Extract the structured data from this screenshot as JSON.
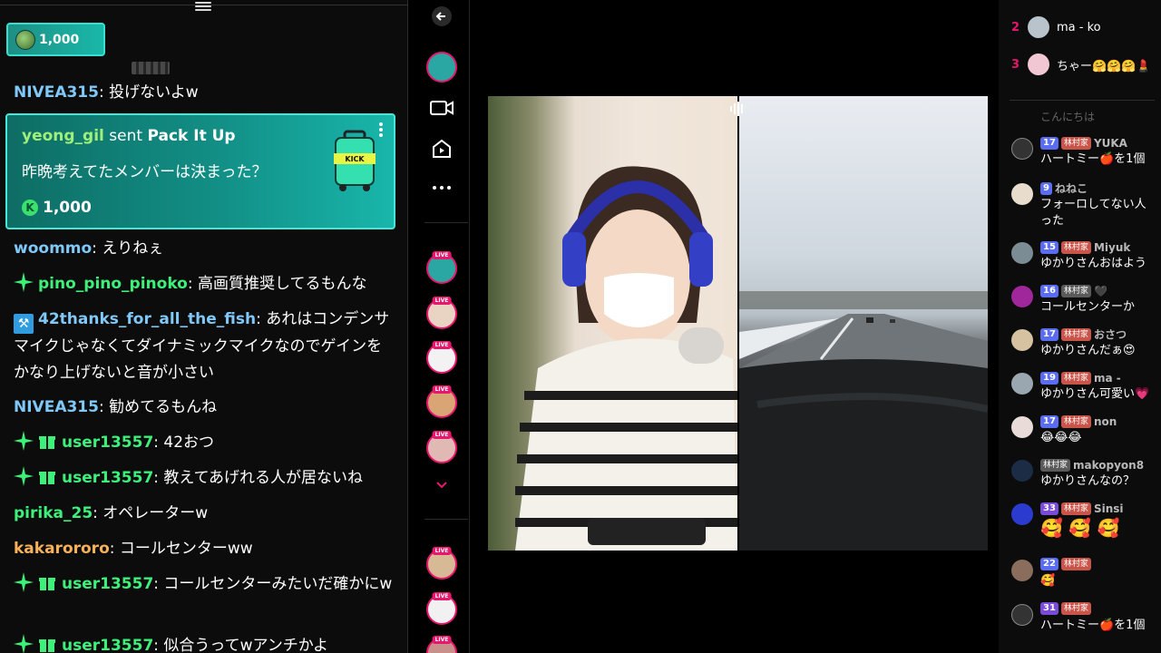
{
  "left_chat": {
    "pinned_coins": "1,000",
    "gift": {
      "user": "yeong_gil",
      "sent_word": "sent",
      "item": "Pack It Up",
      "message": "昨晩考えてたメンバーは決まった？",
      "amount": "1,000",
      "coin_letter": "K"
    },
    "messages": [
      {
        "user": "NIVEA315",
        "text": "投げないよw"
      },
      {
        "user": "woommo",
        "text": "えりねぇ"
      },
      {
        "user": "pino_pino_pinoko",
        "text": "高画質推奨してるもんな"
      },
      {
        "user": "42thanks_for_all_the_fish",
        "text": "あれはコンデンサマイクじゃなくてダイナミックマイクなのでゲインをかなり上げないと音が小さい"
      },
      {
        "user": "NIVEA315",
        "text": "勧めてるもんね"
      },
      {
        "user": "user13557",
        "text": "42おつ"
      },
      {
        "user": "user13557",
        "text": "教えてあげれる人が居ないね"
      },
      {
        "user": "pirika_25",
        "text": "オペレーターw"
      },
      {
        "user": "kakarororo",
        "text": "コールセンターww"
      },
      {
        "user": "user13557",
        "text": "コールセンターみたいだ確かにw"
      },
      {
        "user": "user13557",
        "text": "似合うってwアンチかよ"
      }
    ]
  },
  "right_chat": {
    "ranks": [
      {
        "num": "2",
        "name": "ma - ko"
      },
      {
        "num": "3",
        "name": "ちゃー🤗🤗🤗💄"
      }
    ],
    "faded_text": "こんにちは",
    "messages": [
      {
        "level": "17",
        "fan": "林村家",
        "name": "YUKA",
        "text": "ハートミー🍎を1個"
      },
      {
        "level": "9",
        "fan": "",
        "name": "ねねこ",
        "text": "フォーロしてない人"
      },
      {
        "level": "15",
        "fan": "林村家",
        "name": "Miyuk",
        "text": "ゆかりさんおはよう"
      },
      {
        "level": "16",
        "fan": "林村家",
        "name": "🖤",
        "text": "コールセンターか"
      },
      {
        "level": "17",
        "fan": "林村家",
        "name": "おさつ",
        "text": "ゆかりさんだぁ😍"
      },
      {
        "level": "19",
        "fan": "林村家",
        "name": "ma -",
        "text": "ゆかりさん可愛い💗"
      },
      {
        "level": "17",
        "fan": "林村家",
        "name": "non",
        "text": "😂😂😂"
      },
      {
        "level": "",
        "fan": "林村家",
        "name": "makopyon8",
        "text": "ゆかりさんなの？"
      },
      {
        "level": "33",
        "fan": "林村家",
        "name": "Sinsi",
        "text": "🥰 🥰 🥰"
      },
      {
        "level": "22",
        "fan": "林村家",
        "name": "",
        "text": "🥰"
      },
      {
        "level": "31",
        "fan": "林村家",
        "name": "",
        "text": "ハートミー🍎を1個"
      }
    ],
    "extra_line_1": "った"
  },
  "colors": {
    "accent_teal": "#19b6ab",
    "live_pink": "#e6176c",
    "username_blue": "#7fc8f8",
    "username_green": "#3cf07a",
    "username_orange": "#f7b15a"
  }
}
